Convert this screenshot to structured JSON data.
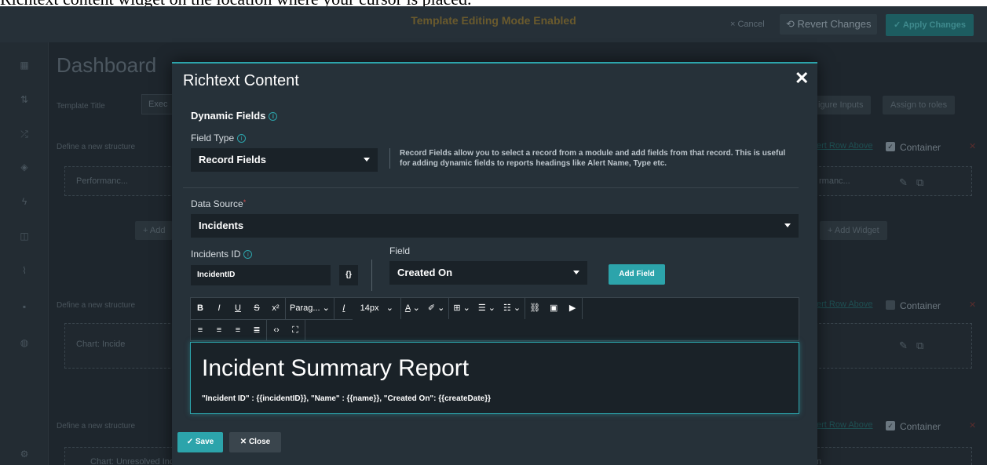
{
  "caption": "Richtext content widget on the location where your cursor is placed.",
  "topbar": {
    "title": "Template Editing Mode Enabled",
    "cancel": "× Cancel",
    "revert": "⟲ Revert Changes",
    "apply": "✓ Apply Changes"
  },
  "background": {
    "page_title": "Dashboard",
    "template_title_label": "Template Title",
    "template_title_value": "Exec",
    "configure_inputs": "igure Inputs",
    "assign_roles": "Assign to roles",
    "define_structure": "Define a new structure",
    "insert_row_above": "ert Row Above",
    "container": "Container",
    "performance_card": "Performanc...",
    "performance_card_right": "rmanc...",
    "add_widget_left": "+ Add",
    "add_widget_right": "+ Add Widget",
    "chart_incident": "Chart: Incide",
    "chart_unresolved": "Chart: Unresolved Inciden"
  },
  "modal": {
    "title": "Richtext Content",
    "close": "✕",
    "dynamic_fields_label": "Dynamic Fields",
    "field_type_label": "Field Type",
    "field_type_value": "Record Fields",
    "field_type_help": "Record Fields allow you to select a record from a module and add fields from that record. This is useful for adding dynamic fields to reports headings like Alert Name, Type etc.",
    "data_source_label": "Data Source",
    "data_source_value": "Incidents",
    "incidents_id_label": "Incidents ID",
    "incidents_id_value": "IncidentID",
    "braces": "{}",
    "field_label": "Field",
    "field_value": "Created On",
    "add_field": "Add Field",
    "toolbar": {
      "bold": "B",
      "italic": "I",
      "underline": "U",
      "strike": "S",
      "superscript": "x²",
      "paragraph": "Parag...",
      "clear_format": "I",
      "font_size": "14px"
    },
    "editor": {
      "heading": "Incident Summary Report",
      "line": "\"Incident ID\" : {{incidentID}}, \"Name\" : {{name}},  \"Created On\": {{createDate}}"
    },
    "save": "✓ Save",
    "close_btn": "✕ Close"
  }
}
